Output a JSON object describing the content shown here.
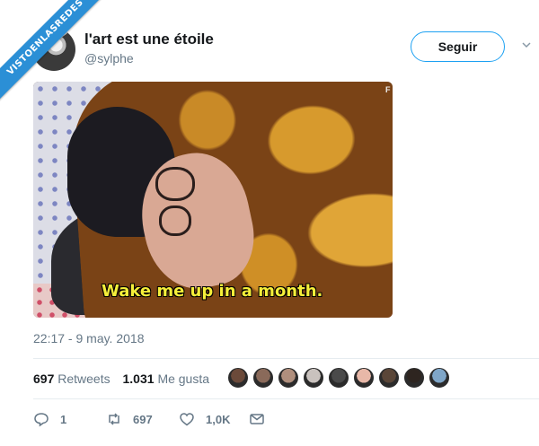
{
  "watermark": "VISTOENLASREDES",
  "tweet": {
    "display_name": "l'art est une étoile",
    "handle": "@sylphe",
    "follow_label": "Seguir",
    "media": {
      "subtitle": "Wake me up in a month.",
      "corner_mark": "F"
    },
    "timestamp": "22:17 - 9 may. 2018",
    "stats": {
      "retweets_count": "697",
      "retweets_label": "Retweets",
      "likes_count": "1.031",
      "likes_label": "Me gusta"
    },
    "likers": [
      "#6b4a3a",
      "#8a6a5a",
      "#b08f7d",
      "#c9c2be",
      "#4a4a4a",
      "#e8b8a8",
      "#5a4638",
      "#2e2520",
      "#7fa6c8"
    ],
    "actions": {
      "reply_count": "1",
      "retweet_count": "697",
      "like_count": "1,0K"
    }
  },
  "colors": {
    "accent": "#1da1f2",
    "secondary_text": "#657786",
    "watermark_bg": "#2b8fd6",
    "subtitle": "#f5ef3a"
  },
  "icons": [
    "avatar",
    "chevron-down-icon",
    "reply-icon",
    "retweet-icon",
    "like-icon",
    "message-icon"
  ]
}
